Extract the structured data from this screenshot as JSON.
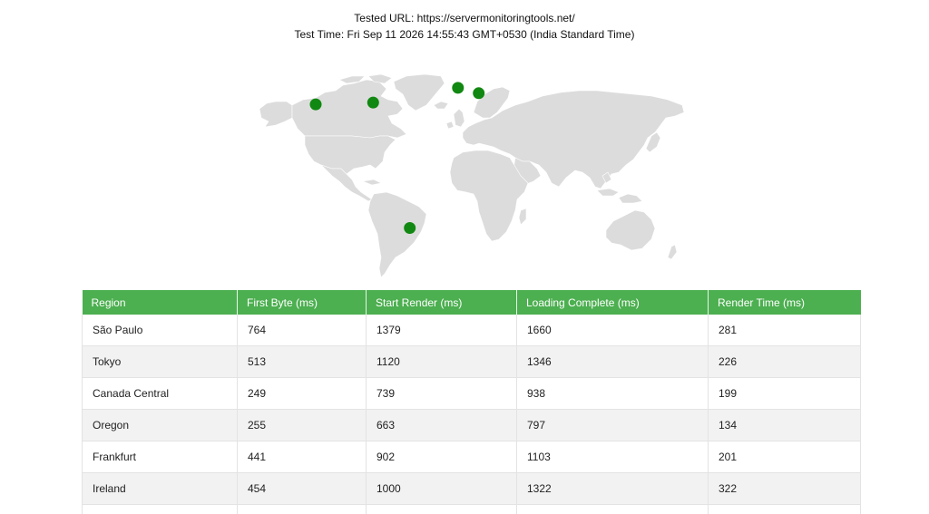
{
  "header": {
    "tested_url": "Tested URL: https://servermonitoringtools.net/",
    "test_time": "Test Time: Fri Sep 11 2026 14:55:43 GMT+0530 (India Standard Time)"
  },
  "map": {
    "land_color": "#dcdcdc",
    "marker_color": "#118811",
    "markers": [
      {
        "name": "Oregon",
        "lon": -122,
        "lat": 44
      },
      {
        "name": "Canada Central",
        "lon": -76,
        "lat": 45
      },
      {
        "name": "Ireland",
        "lon": -8,
        "lat": 53
      },
      {
        "name": "Frankfurt",
        "lon": 8.7,
        "lat": 50.1
      },
      {
        "name": "São Paulo",
        "lon": -46.6,
        "lat": -23.5
      }
    ]
  },
  "table": {
    "header_color": "#4caf50",
    "columns": [
      "Region",
      "First Byte (ms)",
      "Start Render (ms)",
      "Loading Complete (ms)",
      "Render Time (ms)"
    ],
    "rows": [
      [
        "São Paulo",
        "764",
        "1379",
        "1660",
        "281"
      ],
      [
        "Tokyo",
        "513",
        "1120",
        "1346",
        "226"
      ],
      [
        "Canada Central",
        "249",
        "739",
        "938",
        "199"
      ],
      [
        "Oregon",
        "255",
        "663",
        "797",
        "134"
      ],
      [
        "Frankfurt",
        "441",
        "902",
        "1103",
        "201"
      ],
      [
        "Ireland",
        "454",
        "1000",
        "1322",
        "322"
      ],
      [
        "",
        "",
        "",
        "",
        ""
      ]
    ]
  }
}
